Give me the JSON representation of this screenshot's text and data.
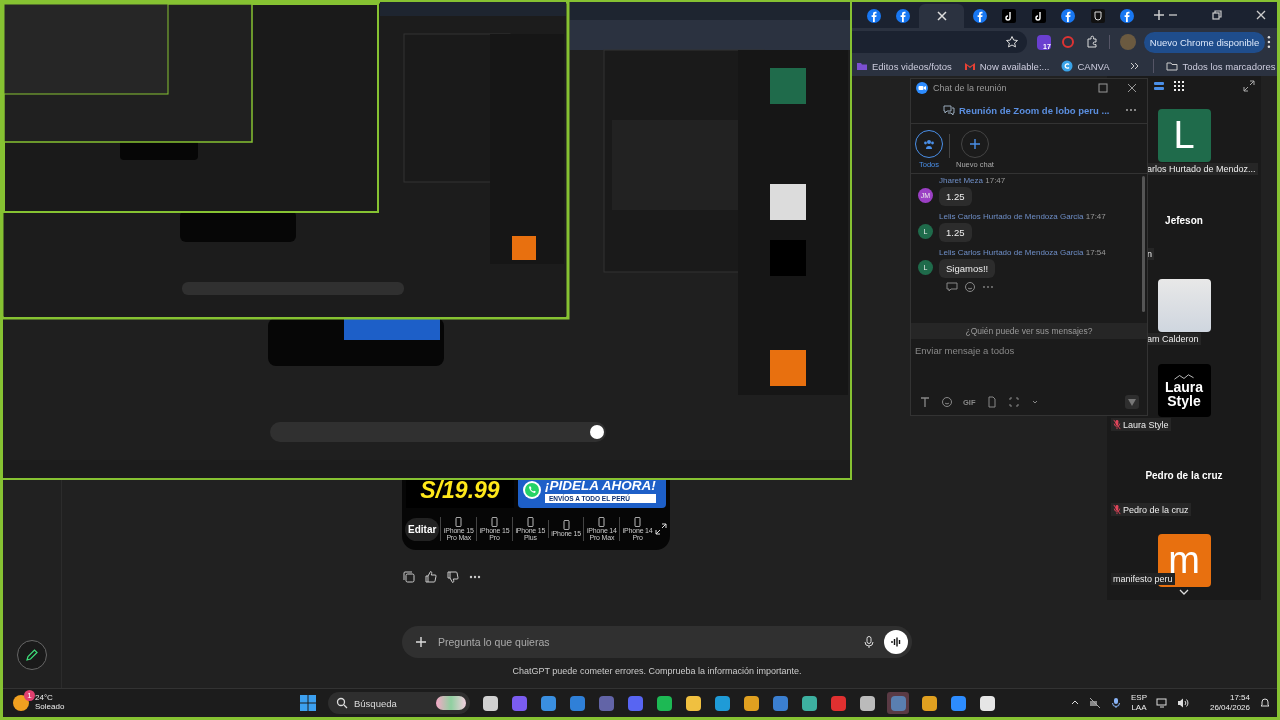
{
  "browser": {
    "tabs": [
      {
        "kind": "facebook",
        "selected": false
      },
      {
        "kind": "facebook",
        "selected": false
      },
      {
        "kind": "blank",
        "selected": true
      },
      {
        "kind": "facebook",
        "selected": false
      },
      {
        "kind": "tiktok",
        "selected": false
      },
      {
        "kind": "tiktok",
        "selected": false
      },
      {
        "kind": "facebook",
        "selected": false
      },
      {
        "kind": "shield",
        "selected": false
      },
      {
        "kind": "facebook",
        "selected": false
      }
    ],
    "extension_badge": "17",
    "update_button": "Nuevo Chrome disponible",
    "bookmarks": [
      {
        "kind": "folder-purple",
        "label": "Editos videos/fotos"
      },
      {
        "kind": "mail",
        "label": "Now available:..."
      },
      {
        "kind": "canva",
        "label": "CANVA"
      }
    ],
    "all_bookmarks": "Todos los marcadores"
  },
  "chatgpt": {
    "image_card": {
      "price": "S/19.99",
      "headline": "¡PIDELA AHORA!",
      "subline": "ENVÍOS A TODO EL PERÚ",
      "edit_button": "Editar",
      "models": [
        "iPhone 15 Pro Max",
        "iPhone 15 Pro",
        "iPhone 15 Plus",
        "iPhone 15",
        "iPhone 14 Pro Max",
        "iPhone 14 Pro"
      ]
    },
    "composer": {
      "placeholder": "Pregunta lo que quieras"
    },
    "disclaimer": "ChatGPT puede cometer errores. Comprueba la información importante."
  },
  "zoom_chat": {
    "title": "Chat de la reunión",
    "meeting": "Reunión de Zoom de lobo peru ...",
    "tabs": [
      {
        "kind": "everyone",
        "label": "Todos",
        "selected": true
      },
      {
        "kind": "new",
        "label": "Nuevo chat",
        "selected": false
      }
    ],
    "messages": [
      {
        "author": "Jharet Meza",
        "time": "17:47",
        "initials": "JM",
        "color": "#9b3fc4",
        "text": "1.25"
      },
      {
        "author": "Lelis Carlos Hurtado de Mendoza Garcia",
        "time": "17:47",
        "initials": "L",
        "color": "#1f6b4b",
        "text": "1.25"
      },
      {
        "author": "Lelis Carlos Hurtado de Mendoza Garcia",
        "time": "17:54",
        "initials": "L",
        "color": "#1f6b4b",
        "text": "Sigamos!!"
      }
    ],
    "privacy_note": "¿Quién puede ver sus mensajes?",
    "input_placeholder": "Enviar mensaje a todos",
    "gif_button": "GIF"
  },
  "participants": [
    {
      "kind": "letter",
      "letter": "L",
      "color": "#1f6b4b",
      "label": "arlos Hurtado de Mendoz...",
      "covered": true,
      "muted": false
    },
    {
      "kind": "name",
      "name": "Jefeson",
      "label": "n",
      "covered": true,
      "muted": false
    },
    {
      "kind": "photo",
      "label": "am Calderon",
      "covered": true,
      "muted": false
    },
    {
      "kind": "logo",
      "logo_top": "Laura",
      "logo_bottom": "Style",
      "label": "Laura Style",
      "covered": false,
      "muted": true
    },
    {
      "kind": "name",
      "name": "Pedro de la cruz",
      "label": "Pedro de la cruz",
      "covered": false,
      "muted": true
    },
    {
      "kind": "letter",
      "letter": "m",
      "color": "#e8700f",
      "label": "manifesto peru",
      "covered": false,
      "muted": false
    }
  ],
  "taskbar": {
    "weather": {
      "temp": "24°C",
      "condition": "Soleado",
      "badge": "1"
    },
    "search": "Búsqueda",
    "apps": [
      {
        "kind": "taskview",
        "selected": false
      },
      {
        "kind": "copilot",
        "selected": false
      },
      {
        "kind": "store",
        "selected": false
      },
      {
        "kind": "mail",
        "selected": false
      },
      {
        "kind": "teams",
        "selected": false
      },
      {
        "kind": "discord",
        "selected": false
      },
      {
        "kind": "spotify",
        "selected": false
      },
      {
        "kind": "folder",
        "selected": false
      },
      {
        "kind": "edge",
        "selected": false
      },
      {
        "kind": "chrome",
        "selected": false
      },
      {
        "kind": "photos",
        "selected": false
      },
      {
        "kind": "globe",
        "selected": false
      },
      {
        "kind": "anydesk",
        "selected": false
      },
      {
        "kind": "clock",
        "selected": false
      },
      {
        "kind": "calculator",
        "selected": true
      },
      {
        "kind": "chrome",
        "selected": false
      },
      {
        "kind": "zoom",
        "selected": false
      },
      {
        "kind": "java",
        "selected": false
      }
    ],
    "language": "ESP",
    "layout": "LAA",
    "time": "17:54",
    "date": "26/04/2026"
  }
}
